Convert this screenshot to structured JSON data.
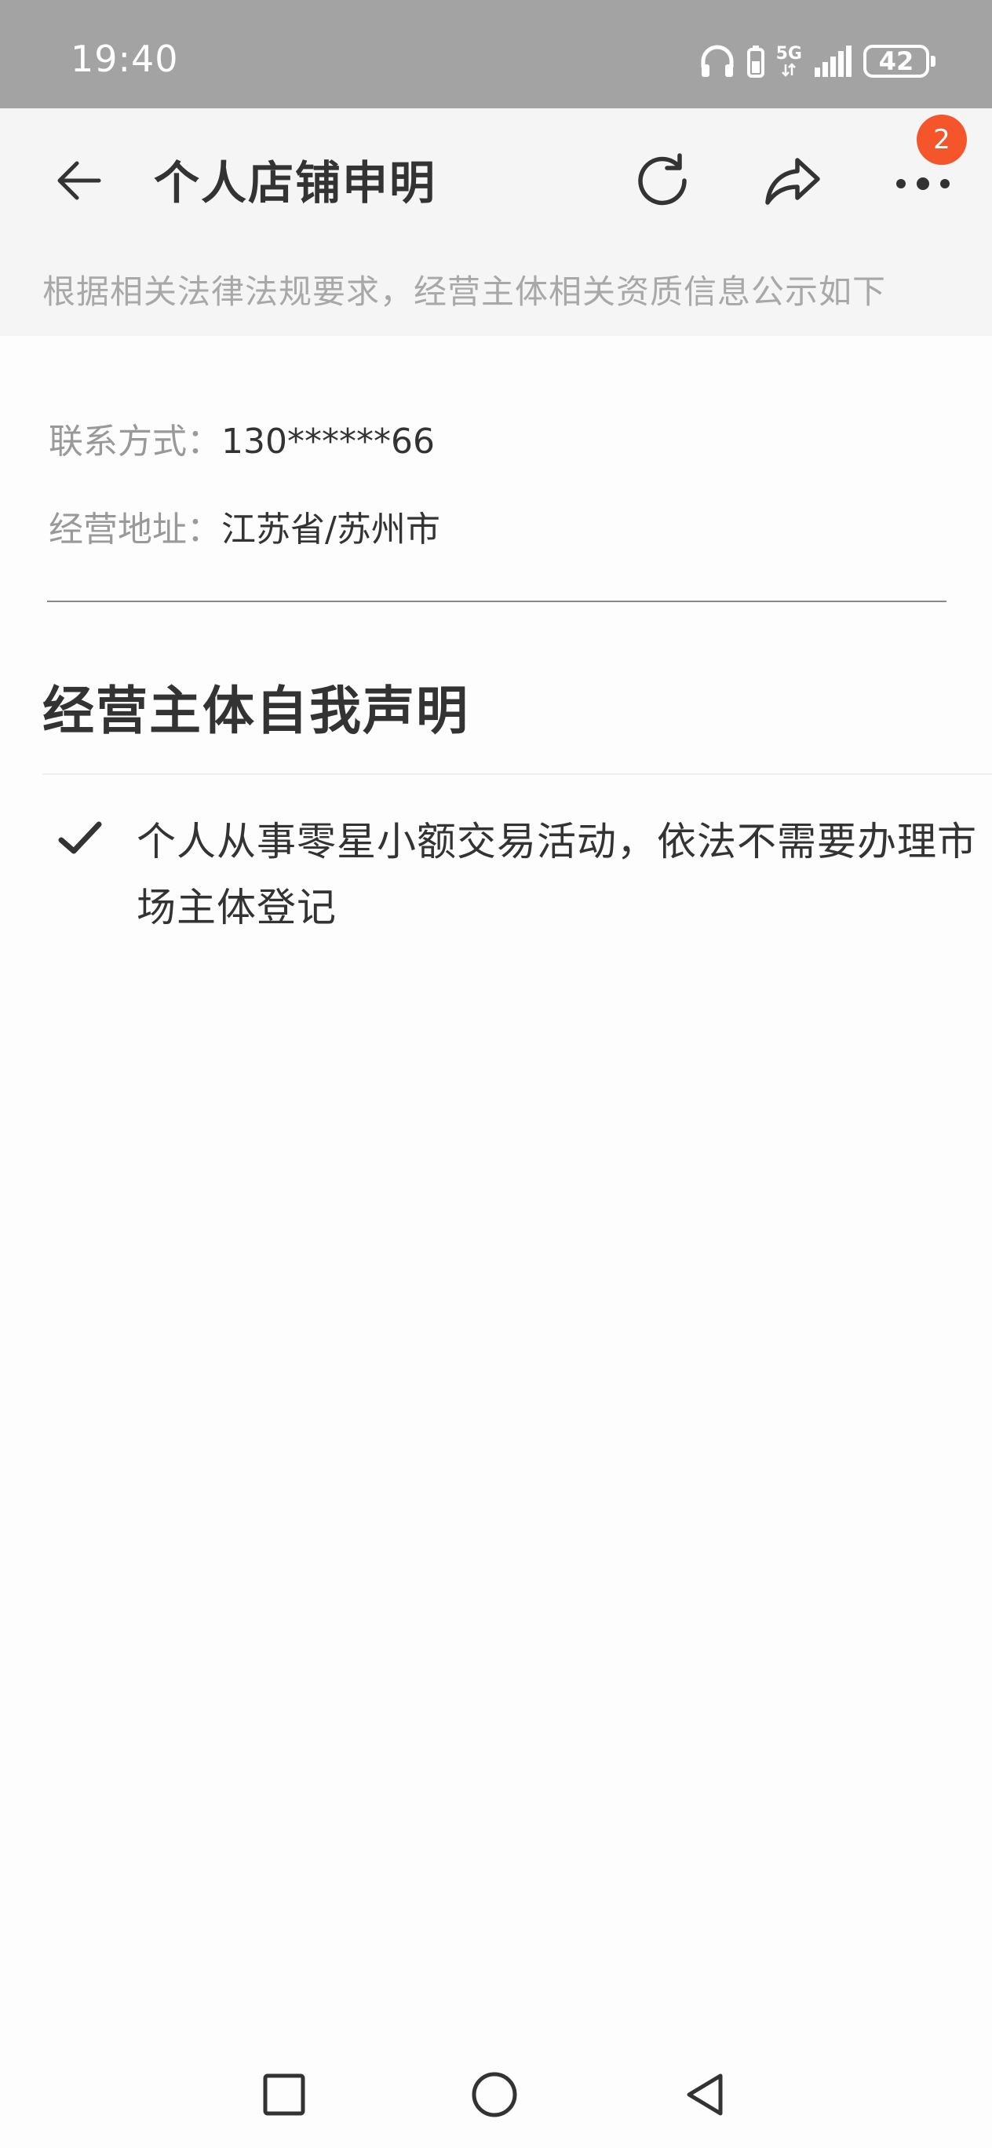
{
  "status_bar": {
    "time": "19:40",
    "network": "5G",
    "battery": "42",
    "icons": [
      "headphones-icon",
      "battery-saver-icon",
      "5g-icon",
      "signal-icon",
      "battery-icon"
    ]
  },
  "header": {
    "title": "个人店铺申明",
    "notification_count": "2",
    "notice": "根据相关法律法规要求，经营主体相关资质信息公示如下",
    "icons": [
      "back-arrow-icon",
      "refresh-icon",
      "share-icon",
      "more-icon"
    ]
  },
  "info": {
    "contact_label": "联系方式：",
    "contact_value": "130******66",
    "address_label": "经营地址：",
    "address_value": "江苏省/苏州市"
  },
  "declaration": {
    "title": "经营主体自我声明",
    "items": [
      {
        "icon": "check-icon",
        "text": "个人从事零星小额交易活动，依法不需要办理市场主体登记"
      }
    ]
  },
  "nav_bar": {
    "icons": [
      "recent-apps-icon",
      "home-icon",
      "back-icon"
    ]
  },
  "colors": {
    "status_bar_bg": "#a3a3a3",
    "header_bg": "#f5f5f5",
    "badge": "#f5552a",
    "text_primary": "#333333",
    "text_secondary": "#999999"
  }
}
